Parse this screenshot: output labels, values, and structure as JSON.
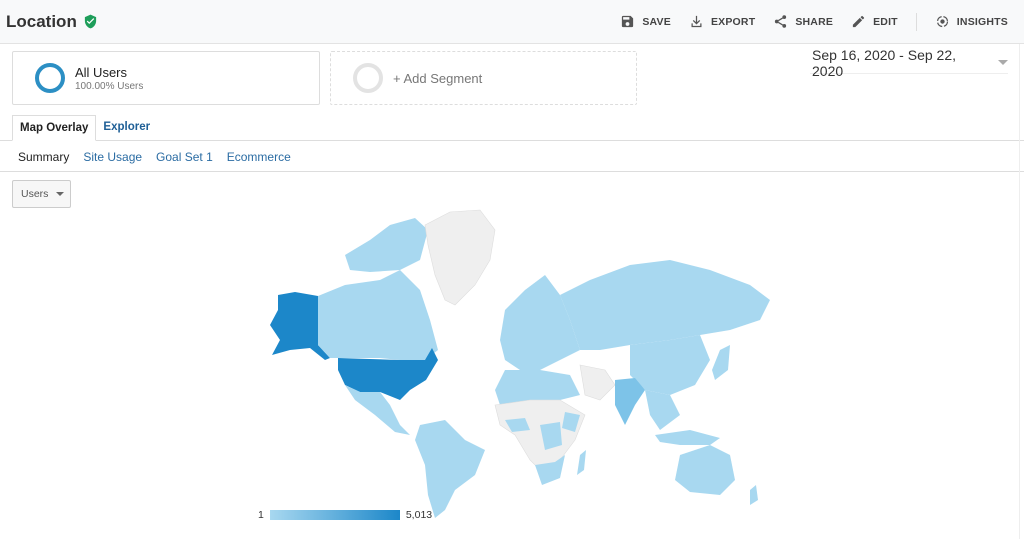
{
  "header": {
    "title": "Location",
    "verified_icon": "shield-check-icon",
    "actions": [
      {
        "label": "SAVE",
        "icon": "save-icon"
      },
      {
        "label": "EXPORT",
        "icon": "download-icon"
      },
      {
        "label": "SHARE",
        "icon": "share-icon"
      },
      {
        "label": "EDIT",
        "icon": "pencil-icon"
      },
      {
        "label": "INSIGHTS",
        "icon": "insights-icon"
      }
    ]
  },
  "segments": {
    "active": {
      "name": "All Users",
      "sub": "100.00% Users"
    },
    "add_label": "+ Add Segment"
  },
  "date_range": "Sep 16, 2020 - Sep 22, 2020",
  "tabs": [
    {
      "label": "Map Overlay",
      "active": true
    },
    {
      "label": "Explorer",
      "active": false
    }
  ],
  "subtabs": [
    {
      "label": "Summary",
      "active": true
    },
    {
      "label": "Site Usage",
      "active": false
    },
    {
      "label": "Goal Set 1",
      "active": false
    },
    {
      "label": "Ecommerce",
      "active": false
    }
  ],
  "metric_select": "Users",
  "map": {
    "colors": {
      "low": "#a8d8f0",
      "high": "#1c87c9",
      "no_data": "#f0f0f0",
      "mid": "#7dc3e8"
    },
    "legend_min": "1",
    "legend_max": "5,013"
  }
}
